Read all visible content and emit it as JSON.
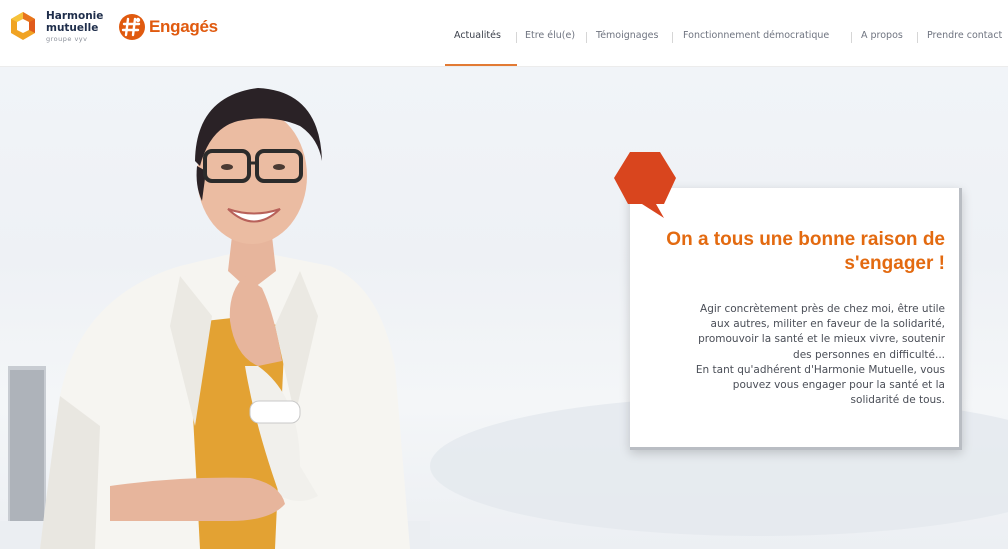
{
  "header": {
    "logo_harmonie": {
      "line1": "Harmonie",
      "line2": "mutuelle",
      "line3": "groupe vyv"
    },
    "logo_engages": {
      "text": "Engagés"
    }
  },
  "nav": {
    "items": [
      {
        "label": "Actualités",
        "active": true
      },
      {
        "label": "Etre élu(e)",
        "active": false
      },
      {
        "label": "Témoignages",
        "active": false
      },
      {
        "label": "Fonctionnement démocratique",
        "active": false
      },
      {
        "label": "A propos",
        "active": false
      },
      {
        "label": "Prendre contact",
        "active": false
      }
    ]
  },
  "hero": {
    "title_lines": [
      "On a tous une bonne raison de",
      "s'engager !"
    ],
    "body_lines": [
      "Agir concrètement près de chez moi, être utile",
      "aux autres, militer en faveur de la solidarité,",
      "promouvoir la santé et le mieux vivre, soutenir",
      "des personnes en difficulté...",
      "En tant qu'adhérent d'Harmonie Mutuelle, vous",
      "pouvez vous engager pour la santé et la",
      "solidarité de tous."
    ]
  },
  "colors": {
    "accent_orange": "#e36a10",
    "bubble_red": "#d9451e",
    "logo_navy": "#1f2e4b"
  },
  "icons": {
    "harmonie_logo": "hexagon-logo-icon",
    "engages_logo": "hashtag-person-icon",
    "speech_bubble": "speech-bubble-icon"
  }
}
